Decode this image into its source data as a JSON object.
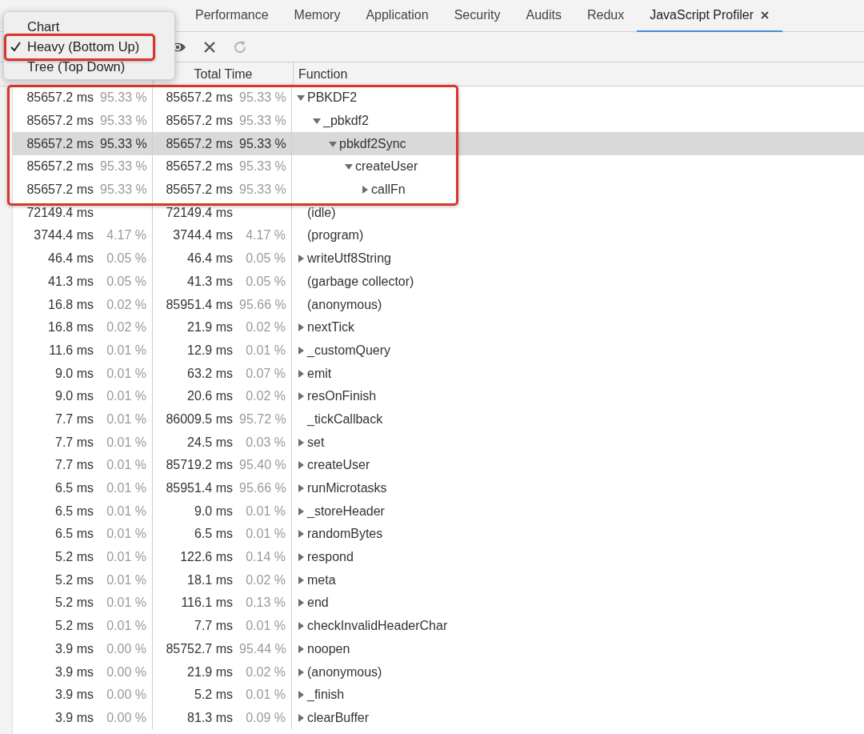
{
  "tabs": [
    {
      "label": "Performance",
      "selected": false,
      "closable": false
    },
    {
      "label": "Memory",
      "selected": false,
      "closable": false
    },
    {
      "label": "Application",
      "selected": false,
      "closable": false
    },
    {
      "label": "Security",
      "selected": false,
      "closable": false
    },
    {
      "label": "Audits",
      "selected": false,
      "closable": false
    },
    {
      "label": "Redux",
      "selected": false,
      "closable": false
    },
    {
      "label": "JavaScript Profiler",
      "selected": true,
      "closable": true
    }
  ],
  "toolbar": {
    "buttons": [
      {
        "kind": "eye",
        "disabled": false
      },
      {
        "kind": "clear",
        "disabled": false
      },
      {
        "kind": "reload",
        "disabled": true
      }
    ]
  },
  "view_menu": {
    "items": [
      {
        "label": "Chart",
        "checked": false,
        "highlighted": false
      },
      {
        "label": "Heavy (Bottom Up)",
        "checked": true,
        "highlighted": true
      },
      {
        "label": "Tree (Top Down)",
        "checked": false,
        "highlighted": false
      }
    ]
  },
  "table": {
    "columns": [
      {
        "label": "Total Time"
      },
      {
        "label": "Function"
      }
    ],
    "rows": [
      {
        "self": "85657.2 ms",
        "self_percent": "95.33 %",
        "total": "85657.2 ms",
        "total_percent": "95.33 %",
        "function": "PBKDF2",
        "expanded": true,
        "selected": false,
        "highlighted": true,
        "children": [
          {
            "self": "85657.2 ms",
            "self_percent": "95.33 %",
            "total": "85657.2 ms",
            "total_percent": "95.33 %",
            "function": "_pbkdf2",
            "expanded": true,
            "selected": false,
            "children": [
              {
                "self": "85657.2 ms",
                "self_percent": "95.33 %",
                "total": "85657.2 ms",
                "total_percent": "95.33 %",
                "function": "pbkdf2Sync",
                "expanded": true,
                "selected": true,
                "children": [
                  {
                    "self": "85657.2 ms",
                    "self_percent": "95.33 %",
                    "total": "85657.2 ms",
                    "total_percent": "95.33 %",
                    "function": "createUser",
                    "expanded": true,
                    "selected": false,
                    "children": [
                      {
                        "self": "85657.2 ms",
                        "self_percent": "95.33 %",
                        "total": "85657.2 ms",
                        "total_percent": "95.33 %",
                        "function": "callFn",
                        "expanded": false,
                        "selected": false
                      }
                    ]
                  }
                ]
              }
            ]
          }
        ]
      },
      {
        "self": "72149.4 ms",
        "total": "72149.4 ms",
        "function": "(idle)",
        "selected": false
      },
      {
        "self": "3744.4 ms",
        "self_percent": "4.17 %",
        "total": "3744.4 ms",
        "total_percent": "4.17 %",
        "function": "(program)",
        "selected": false
      },
      {
        "self": "46.4 ms",
        "self_percent": "0.05 %",
        "total": "46.4 ms",
        "total_percent": "0.05 %",
        "function": "writeUtf8String",
        "expanded": false,
        "selected": false
      },
      {
        "self": "41.3 ms",
        "self_percent": "0.05 %",
        "total": "41.3 ms",
        "total_percent": "0.05 %",
        "function": "(garbage collector)",
        "selected": false
      },
      {
        "self": "16.8 ms",
        "self_percent": "0.02 %",
        "total": "85951.4 ms",
        "total_percent": "95.66 %",
        "function": "(anonymous)",
        "selected": false
      },
      {
        "self": "16.8 ms",
        "self_percent": "0.02 %",
        "total": "21.9 ms",
        "total_percent": "0.02 %",
        "function": "nextTick",
        "expanded": false,
        "selected": false
      },
      {
        "self": "11.6 ms",
        "self_percent": "0.01 %",
        "total": "12.9 ms",
        "total_percent": "0.01 %",
        "function": "_customQuery",
        "expanded": false,
        "selected": false
      },
      {
        "self": "9.0 ms",
        "self_percent": "0.01 %",
        "total": "63.2 ms",
        "total_percent": "0.07 %",
        "function": "emit",
        "expanded": false,
        "selected": false
      },
      {
        "self": "9.0 ms",
        "self_percent": "0.01 %",
        "total": "20.6 ms",
        "total_percent": "0.02 %",
        "function": "resOnFinish",
        "expanded": false,
        "selected": false
      },
      {
        "self": "7.7 ms",
        "self_percent": "0.01 %",
        "total": "86009.5 ms",
        "total_percent": "95.72 %",
        "function": "_tickCallback",
        "selected": false
      },
      {
        "self": "7.7 ms",
        "self_percent": "0.01 %",
        "total": "24.5 ms",
        "total_percent": "0.03 %",
        "function": "set",
        "expanded": false,
        "selected": false
      },
      {
        "self": "7.7 ms",
        "self_percent": "0.01 %",
        "total": "85719.2 ms",
        "total_percent": "95.40 %",
        "function": "createUser",
        "expanded": false,
        "selected": false
      },
      {
        "self": "6.5 ms",
        "self_percent": "0.01 %",
        "total": "85951.4 ms",
        "total_percent": "95.66 %",
        "function": "runMicrotasks",
        "expanded": false,
        "selected": false
      },
      {
        "self": "6.5 ms",
        "self_percent": "0.01 %",
        "total": "9.0 ms",
        "total_percent": "0.01 %",
        "function": "_storeHeader",
        "expanded": false,
        "selected": false
      },
      {
        "self": "6.5 ms",
        "self_percent": "0.01 %",
        "total": "6.5 ms",
        "total_percent": "0.01 %",
        "function": "randomBytes",
        "expanded": false,
        "selected": false
      },
      {
        "self": "5.2 ms",
        "self_percent": "0.01 %",
        "total": "122.6 ms",
        "total_percent": "0.14 %",
        "function": "respond",
        "expanded": false,
        "selected": false
      },
      {
        "self": "5.2 ms",
        "self_percent": "0.01 %",
        "total": "18.1 ms",
        "total_percent": "0.02 %",
        "function": "meta",
        "expanded": false,
        "selected": false
      },
      {
        "self": "5.2 ms",
        "self_percent": "0.01 %",
        "total": "116.1 ms",
        "total_percent": "0.13 %",
        "function": "end",
        "expanded": false,
        "selected": false
      },
      {
        "self": "5.2 ms",
        "self_percent": "0.01 %",
        "total": "7.7 ms",
        "total_percent": "0.01 %",
        "function": "checkInvalidHeaderChar",
        "expanded": false,
        "selected": false
      },
      {
        "self": "3.9 ms",
        "self_percent": "0.00 %",
        "total": "85752.7 ms",
        "total_percent": "95.44 %",
        "function": "noopen",
        "expanded": false,
        "selected": false
      },
      {
        "self": "3.9 ms",
        "self_percent": "0.00 %",
        "total": "21.9 ms",
        "total_percent": "0.02 %",
        "function": "(anonymous)",
        "expanded": false,
        "selected": false
      },
      {
        "self": "3.9 ms",
        "self_percent": "0.00 %",
        "total": "5.2 ms",
        "total_percent": "0.01 %",
        "function": "_finish",
        "expanded": false,
        "selected": false
      },
      {
        "self": "3.9 ms",
        "self_percent": "0.00 %",
        "total": "81.3 ms",
        "total_percent": "0.09 %",
        "function": "clearBuffer",
        "expanded": false,
        "selected": false
      }
    ]
  }
}
